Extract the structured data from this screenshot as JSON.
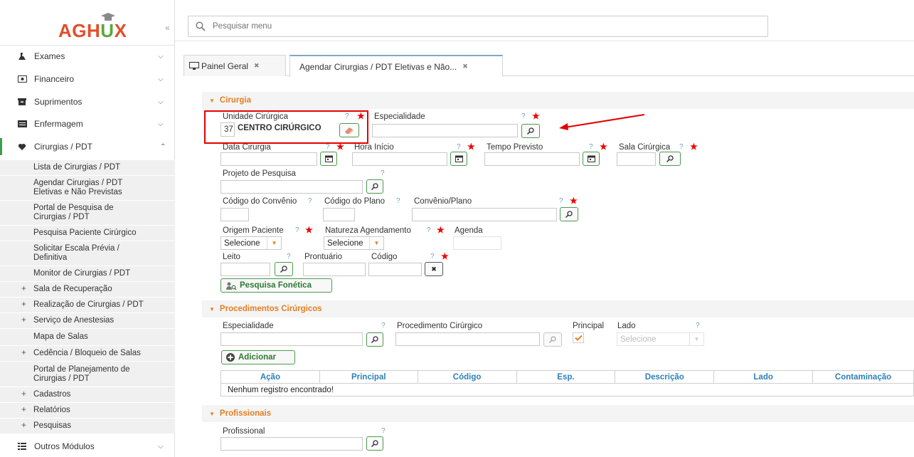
{
  "logo": {
    "text_a": "AGH",
    "text_u": "U",
    "text_x": "X"
  },
  "sidebar": {
    "collapse_label": "«",
    "items": [
      {
        "label": "Exames",
        "icon": "microscope-icon"
      },
      {
        "label": "Financeiro",
        "icon": "money-icon"
      },
      {
        "label": "Suprimentos",
        "icon": "box-icon"
      },
      {
        "label": "Enfermagem",
        "icon": "card-icon"
      },
      {
        "label": "Cirurgias / PDT",
        "icon": "heart-icon"
      }
    ],
    "subitems": [
      "Lista de Cirurgias / PDT",
      "Agendar Cirurgias / PDT Eletivas e Não Previstas",
      "Portal de Pesquisa de Cirurgias / PDT",
      "Pesquisa Paciente Cirúrgico",
      "Solicitar Escala Prévia / Definitiva",
      "Monitor de Cirurgias / PDT",
      "Sala de Recuperação",
      "Realização de Cirurgias / PDT",
      "Serviço de Anestesias",
      "Mapa de Salas",
      "Cedência / Bloqueio de Salas",
      "Portal de Planejamento de Cirurgias / PDT",
      "Cadastros",
      "Relatórios",
      "Pesquisas"
    ],
    "bottom_item": "Outros Módulos"
  },
  "search": {
    "placeholder": "Pesquisar menu"
  },
  "tabs": [
    {
      "label": "Painel Geral"
    },
    {
      "label": "Agendar Cirurgias / PDT Eletivas e Não..."
    }
  ],
  "cirurgia": {
    "title": "Cirurgia",
    "unidade_label": "Unidade Cirúrgica",
    "unidade_code": "37",
    "unidade_name": "CENTRO CIRÚRGICO",
    "especialidade_label": "Especialidade",
    "data_label": "Data Cirurgia",
    "hora_label": "Hora Início",
    "tempo_label": "Tempo Previsto",
    "sala_label": "Sala Cirúrgica",
    "projeto_label": "Projeto de Pesquisa",
    "cod_convenio_label": "Código do Convênio",
    "cod_plano_label": "Código do Plano",
    "convenio_label": "Convênio/Plano",
    "origem_label": "Origem Paciente",
    "natureza_label": "Natureza Agendamento",
    "agenda_label": "Agenda",
    "origem_value": "Selecione",
    "natureza_value": "Selecione",
    "leito_label": "Leito",
    "prontuario_label": "Prontuário",
    "codigo_label": "Código",
    "fonetica_btn": "Pesquisa Fonética"
  },
  "procedimentos": {
    "title": "Procedimentos Cirúrgicos",
    "especialidade_label": "Especialidade",
    "procedimento_label": "Procedimento Cirúrgico",
    "principal_label": "Principal",
    "lado_label": "Lado",
    "lado_value": "Selecione",
    "add_btn": "Adicionar",
    "columns": [
      "Ação",
      "Principal",
      "Código",
      "Esp.",
      "Descrição",
      "Lado",
      "Contaminação"
    ],
    "empty": "Nenhum registro encontrado!"
  },
  "profissionais": {
    "title": "Profissionais",
    "profissional_label": "Profissional"
  },
  "colors": {
    "accent": "#e67e22",
    "green": "#4c9a4f",
    "link": "#2e80b8",
    "required": "#ee0000"
  }
}
